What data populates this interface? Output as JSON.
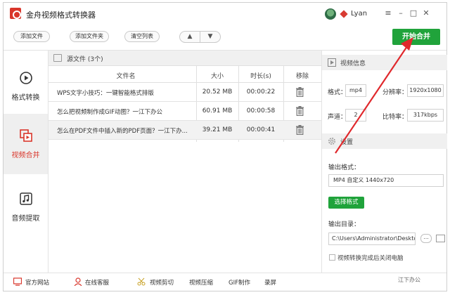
{
  "window": {
    "title": "金舟视频格式转换器",
    "user": "Lyan"
  },
  "toolbar": {
    "add_file": "添加文件",
    "add_folder": "添加文件夹",
    "clear_list": "清空列表",
    "move_up": "▲",
    "move_down": "▼",
    "start_merge": "开始合并"
  },
  "sidebar": {
    "items": [
      {
        "label": "格式转换",
        "icon": "play-circle-icon",
        "active": false
      },
      {
        "label": "视频合并",
        "icon": "merge-icon",
        "active": true
      },
      {
        "label": "音频提取",
        "icon": "music-note-icon",
        "active": false
      }
    ]
  },
  "file_list": {
    "source_title": "源文件 (3个)",
    "columns": {
      "name": "文件名",
      "size": "大小",
      "duration": "时长(s)",
      "remove": "移除"
    },
    "rows": [
      {
        "name": "WPS文字小技巧：一键智能格式排版",
        "size": "20.52 MB",
        "duration": "00:00:22",
        "selected": false
      },
      {
        "name": "怎么把视频制作成GIF动图？一江下办公",
        "size": "60.91 MB",
        "duration": "00:00:58",
        "selected": false
      },
      {
        "name": "怎么在PDF文件中插入新的PDF页面？一江下办...",
        "size": "39.21 MB",
        "duration": "00:00:41",
        "selected": true
      }
    ]
  },
  "video_info": {
    "title": "视频信息",
    "format_label": "格式：",
    "format_value": "mp4",
    "resolution_label": "分辨率：",
    "resolution_value": "1920x1080",
    "channels_label": "声道：",
    "channels_value": "2",
    "bitrate_label": "比特率：",
    "bitrate_value": "317kbps"
  },
  "settings": {
    "title": "设置",
    "output_format_label": "输出格式：",
    "output_format_value": "MP4 自定义 1440x720",
    "choose_format": "选择格式",
    "output_dir_label": "输出目录：",
    "output_dir_value": "C:\\Users\\Administrator\\Deskto",
    "browse": "...",
    "shutdown_label": "视频转换完成后关闭电脑"
  },
  "statusbar": {
    "website": "官方网站",
    "support": "在线客服",
    "video_cut": "视频剪切",
    "video_compress": "视频压缩",
    "gif": "GIF制作",
    "record": "录屏"
  },
  "watermark": "江下办公",
  "colors": {
    "accent_green": "#20a33b",
    "brand_red": "#d9362b",
    "annotation_red": "#e0282c"
  }
}
